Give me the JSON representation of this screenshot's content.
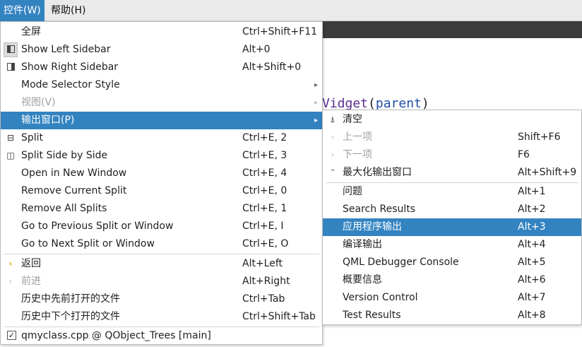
{
  "menubar": {
    "items": [
      {
        "label": "控件(W)",
        "active": true
      },
      {
        "label": "帮助(H)",
        "active": false
      }
    ]
  },
  "editor": {
    "code_fragment": "Vidget",
    "code_paren_open": "(",
    "code_param": "parent",
    "code_paren_close": ")"
  },
  "main_menu": {
    "items": [
      {
        "label": "全屏",
        "shortcut": "Ctrl+Shift+F11"
      },
      {
        "label": "Show Left Sidebar",
        "shortcut": "Alt+0",
        "icon": "left-sidebar-icon"
      },
      {
        "label": "Show Right Sidebar",
        "shortcut": "Alt+Shift+0",
        "icon": "right-sidebar-icon"
      },
      {
        "label": "Mode Selector Style",
        "shortcut": "",
        "submenu": true
      },
      {
        "label": "视图(V)",
        "shortcut": "",
        "submenu": true,
        "disabled": true
      },
      {
        "label": "输出窗口(P)",
        "shortcut": "",
        "submenu": true,
        "highlighted": true
      },
      {
        "label": "Split",
        "shortcut": "Ctrl+E, 2",
        "icon": "split-icon"
      },
      {
        "label": "Split Side by Side",
        "shortcut": "Ctrl+E, 3",
        "icon": "split-side-icon"
      },
      {
        "label": "Open in New Window",
        "shortcut": "Ctrl+E, 4"
      },
      {
        "label": "Remove Current Split",
        "shortcut": "Ctrl+E, 0"
      },
      {
        "label": "Remove All Splits",
        "shortcut": "Ctrl+E, 1"
      },
      {
        "label": "Go to Previous Split or Window",
        "shortcut": "Ctrl+E, I"
      },
      {
        "label": "Go to Next Split or Window",
        "shortcut": "Ctrl+E, O"
      },
      {
        "label": "返回",
        "shortcut": "Alt+Left",
        "icon": "chevron-left-icon"
      },
      {
        "label": "前进",
        "shortcut": "Alt+Right",
        "icon": "chevron-right-icon",
        "disabled": true
      },
      {
        "label": "历史中先前打开的文件",
        "shortcut": "Ctrl+Tab"
      },
      {
        "label": "历史中下个打开的文件",
        "shortcut": "Ctrl+Shift+Tab"
      },
      {
        "label": "qmyclass.cpp @ QObject_Trees [main]",
        "shortcut": "",
        "checked": true
      }
    ]
  },
  "submenu": {
    "items": [
      {
        "label": "清空",
        "shortcut": "",
        "icon": "broom-icon"
      },
      {
        "label": "上一项",
        "shortcut": "Shift+F6",
        "icon": "chevron-left-icon",
        "disabled": true
      },
      {
        "label": "下一项",
        "shortcut": "F6",
        "icon": "chevron-right-icon",
        "disabled": true
      },
      {
        "label": "最大化输出窗口",
        "shortcut": "Alt+Shift+9",
        "icon": "chevron-up-icon"
      },
      {
        "label": "问题",
        "shortcut": "Alt+1"
      },
      {
        "label": "Search Results",
        "shortcut": "Alt+2"
      },
      {
        "label": "应用程序输出",
        "shortcut": "Alt+3",
        "highlighted": true
      },
      {
        "label": "编译输出",
        "shortcut": "Alt+4"
      },
      {
        "label": "QML Debugger Console",
        "shortcut": "Alt+5"
      },
      {
        "label": "概要信息",
        "shortcut": "Alt+6"
      },
      {
        "label": "Version Control",
        "shortcut": "Alt+7"
      },
      {
        "label": "Test Results",
        "shortcut": "Alt+8"
      }
    ]
  },
  "colors": {
    "highlight": "#3383c1",
    "menubar_bg": "#eaeaea",
    "editor_dark": "#3c3c3c",
    "disabled_text": "#a0a0a0"
  }
}
